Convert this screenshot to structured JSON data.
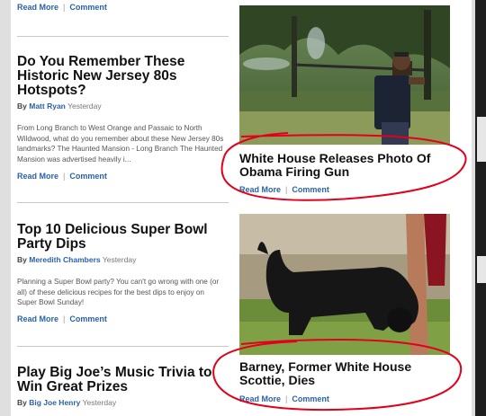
{
  "links": {
    "read_more": "Read More",
    "separator": "|",
    "comment": "Comment"
  },
  "left_column": {
    "articles": [
      {
        "title": "Do You Remember These Historic New Jersey 80s Hotspots?",
        "by_label": "By",
        "author": "Matt Ryan",
        "date": "Yesterday",
        "excerpt": "From Long Branch to West Orange and Passaic to North Wildwood, what do you remember about these New Jersey 80s landmarks? The Haunted Mansion - Long Branch    The Haunted Mansion was advertised heavily i..."
      },
      {
        "title": "Top 10 Delicious Super Bowl Party Dips",
        "by_label": "By",
        "author": "Meredith Chambers",
        "date": "Yesterday",
        "excerpt": "Planning a Super Bowl party? You can't go wrong with one (or all) of these delicious recipes for the best dips to enjoy on Super Bowl Sunday!"
      },
      {
        "title": "Play Big Joe’s Music Trivia to Win Great Prizes",
        "by_label": "By",
        "author": "Big Joe Henry",
        "date": "Yesterday"
      }
    ]
  },
  "right_column": {
    "features": [
      {
        "title": "White House Releases Photo Of Obama Firing Gun"
      },
      {
        "title": "Barney, Former White House Scottie, Dies"
      }
    ]
  },
  "colors": {
    "link": "#2a62a8",
    "annotation": "#e2001a",
    "divider": "#c9c9c9"
  }
}
